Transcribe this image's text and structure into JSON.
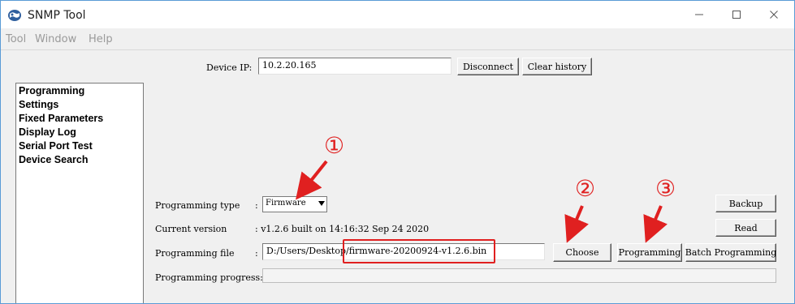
{
  "window": {
    "title": "SNMP Tool",
    "accent_color": "#e02020",
    "icons": {
      "app": "globe-icon",
      "minimize": "minimize-icon",
      "maximize": "maximize-icon",
      "close": "close-icon"
    }
  },
  "menu": {
    "items": [
      "Tool",
      "Window",
      "Help"
    ]
  },
  "device": {
    "ip_label": "Device IP:",
    "ip_value": "10.2.20.165",
    "disconnect_label": "Disconnect",
    "clear_history_label": "Clear history"
  },
  "sidebar": {
    "items": [
      "Programming",
      "Settings",
      "Fixed Parameters",
      "Display Log",
      "Serial Port Test",
      "Device Search"
    ]
  },
  "programming": {
    "type_label": "Programming type",
    "type_colon": ":",
    "type_value": "Firmware",
    "version_label": "Current version",
    "version_value": ": v1.2.6 built on 14:16:32 Sep 24 2020",
    "file_label": "Programming file",
    "file_colon": ":",
    "file_path_prefix": "D:/Users/Desktop",
    "file_path_name": "/firmware-20200924-v1.2.6.bin",
    "progress_label": "Programming progress:",
    "progress_value": 0,
    "choose_label": "Choose",
    "programming_label": "Programming",
    "batch_label": "Batch Programming",
    "backup_label": "Backup",
    "read_label": "Read"
  },
  "annotations": {
    "step1": "①",
    "step2": "②",
    "step3": "③"
  }
}
